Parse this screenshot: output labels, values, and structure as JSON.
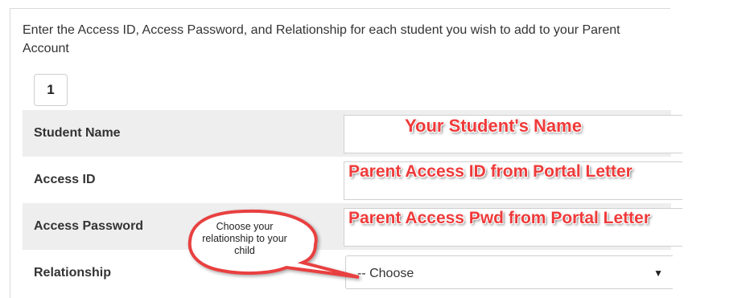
{
  "intro": "Enter the Access ID, Access Password, and Relationship for each student you wish to add to your Parent Account",
  "student_index": "1",
  "rows": [
    {
      "label": "Student Name",
      "annotation": "Your Student's Name"
    },
    {
      "label": "Access ID",
      "annotation": "Parent Access ID from Portal Letter"
    },
    {
      "label": "Access Password",
      "annotation": "Parent Access Pwd from Portal Letter"
    },
    {
      "label": "Relationship"
    }
  ],
  "relationship_select": {
    "value": "-- Choose",
    "icon": "caret-down-icon"
  },
  "callout": {
    "text": "Choose your relationship to your child"
  },
  "colors": {
    "annotation": "#ef3a3a",
    "callout_border": "#e8403f",
    "row_shade": "#eeeeee"
  }
}
